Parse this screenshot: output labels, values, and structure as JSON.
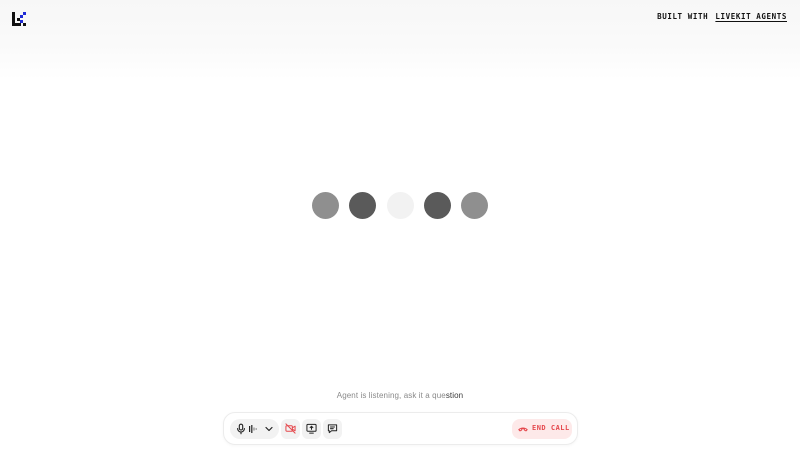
{
  "header": {
    "logo_icon": "livekit-logo-icon",
    "built_with_prefix": "BUILT WITH",
    "built_with_link": "LIVEKIT AGENTS"
  },
  "agent": {
    "visualizer_bars": 5,
    "status_prefix": "Agent is listening, ask it a que",
    "status_highlight": "stion"
  },
  "controls": {
    "mic_icon": "microphone-icon",
    "mic_level_icon": "audio-level-icon",
    "mic_menu_icon": "chevron-down-icon",
    "camera_icon": "camera-off-icon",
    "screen_share_icon": "screen-share-icon",
    "chat_icon": "chat-icon",
    "end_call_icon": "phone-hangup-icon",
    "end_call_label": "END CALL"
  },
  "colors": {
    "accent_blue": "#1f2bd6",
    "danger": "#e5484d",
    "danger_bg": "#fde9e9"
  }
}
